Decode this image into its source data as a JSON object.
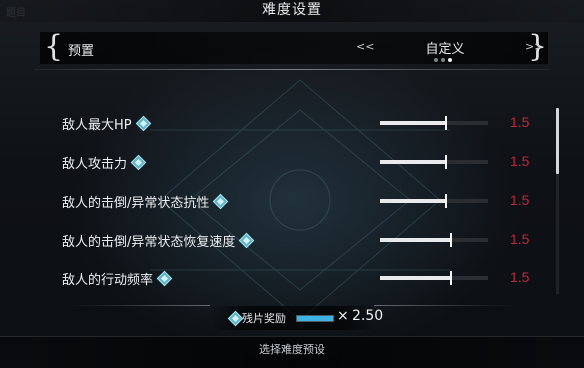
{
  "header": {
    "title": "难度设置",
    "corner_text": "题目"
  },
  "preset": {
    "label": "预置",
    "value": "自定义",
    "prev_icon": "double-left-chevron",
    "next_icon": "double-right-chevron",
    "page_count": 3,
    "active_page": 3
  },
  "settings": [
    {
      "label": "敌人最大HP",
      "value": "1.5",
      "level": 0.61
    },
    {
      "label": "敌人攻击力",
      "value": "1.5",
      "level": 0.61
    },
    {
      "label": "敌人的击倒/异常状态抗性",
      "value": "1.5",
      "level": 0.61
    },
    {
      "label": "敌人的击倒/异常状态恢复速度",
      "value": "1.5",
      "level": 0.66
    },
    {
      "label": "敌人的行动频率",
      "value": "1.5",
      "level": 0.66
    }
  ],
  "reward": {
    "label": "残片奖励",
    "multiplier_symbol": "×",
    "value": "2.50",
    "meter_level": 1.0,
    "icon": "diamond-icon"
  },
  "footer": {
    "hint": "选择难度预设"
  },
  "colors": {
    "value_red": "#c4253b",
    "accent_cyan": "#5fb7c9",
    "meter_blue": "#3fb4e2"
  }
}
